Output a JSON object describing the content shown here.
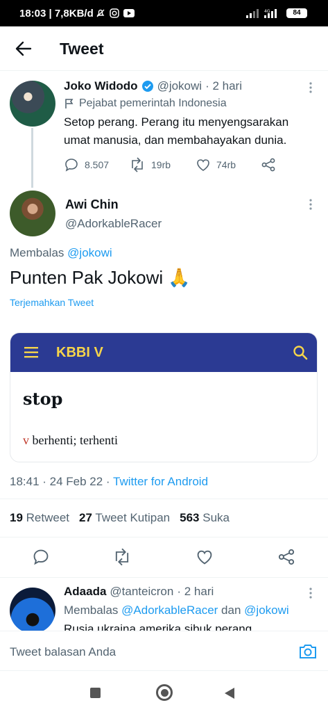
{
  "status_bar": {
    "time": "18:03 | 7,8KB/d",
    "battery": "84"
  },
  "header": {
    "title": "Tweet"
  },
  "parent_tweet": {
    "name": "Joko Widodo",
    "handle": "@jokowi",
    "time": "· 2 hari",
    "label": "Pejabat pemerintah Indonesia",
    "text": "Setop perang. Perang itu menyengsarakan umat manusia, dan membahayakan dunia.",
    "replies": "8.507",
    "retweets": "19rb",
    "likes": "74rb"
  },
  "main_tweet": {
    "name": "Awi Chin",
    "handle": "@AdorkableRacer",
    "reply_prefix": "Membalas",
    "reply_to": "@jokowi",
    "text": "Punten Pak Jokowi 🙏",
    "translate": "Terjemahkan Tweet",
    "image": {
      "app_title": "KBBI V",
      "word": "stop",
      "pos": "v",
      "definition": "berhenti; terhenti"
    },
    "timestamp": "18:41 · 24 Feb 22 · ",
    "source": "Twitter for Android",
    "stats": {
      "retweets_count": "19",
      "retweets_label": "Retweet",
      "quotes_count": "27",
      "quotes_label": "Tweet Kutipan",
      "likes_count": "563",
      "likes_label": "Suka"
    }
  },
  "reply_tweet": {
    "name": "Adaada",
    "handle": "@tanteicron",
    "time": "· 2 hari",
    "reply_prefix": "Membalas",
    "reply_to_1": "@AdorkableRacer",
    "reply_and": "dan",
    "reply_to_2": "@jokowi",
    "text": "Rusia ukraina amerika sibuk perang"
  },
  "composer": {
    "placeholder": "Tweet balasan Anda"
  },
  "colors": {
    "accent": "#1d9bf0",
    "kbbi_bar": "#2b3a93",
    "kbbi_title": "#f7d54a",
    "pos": "#c0392b"
  }
}
